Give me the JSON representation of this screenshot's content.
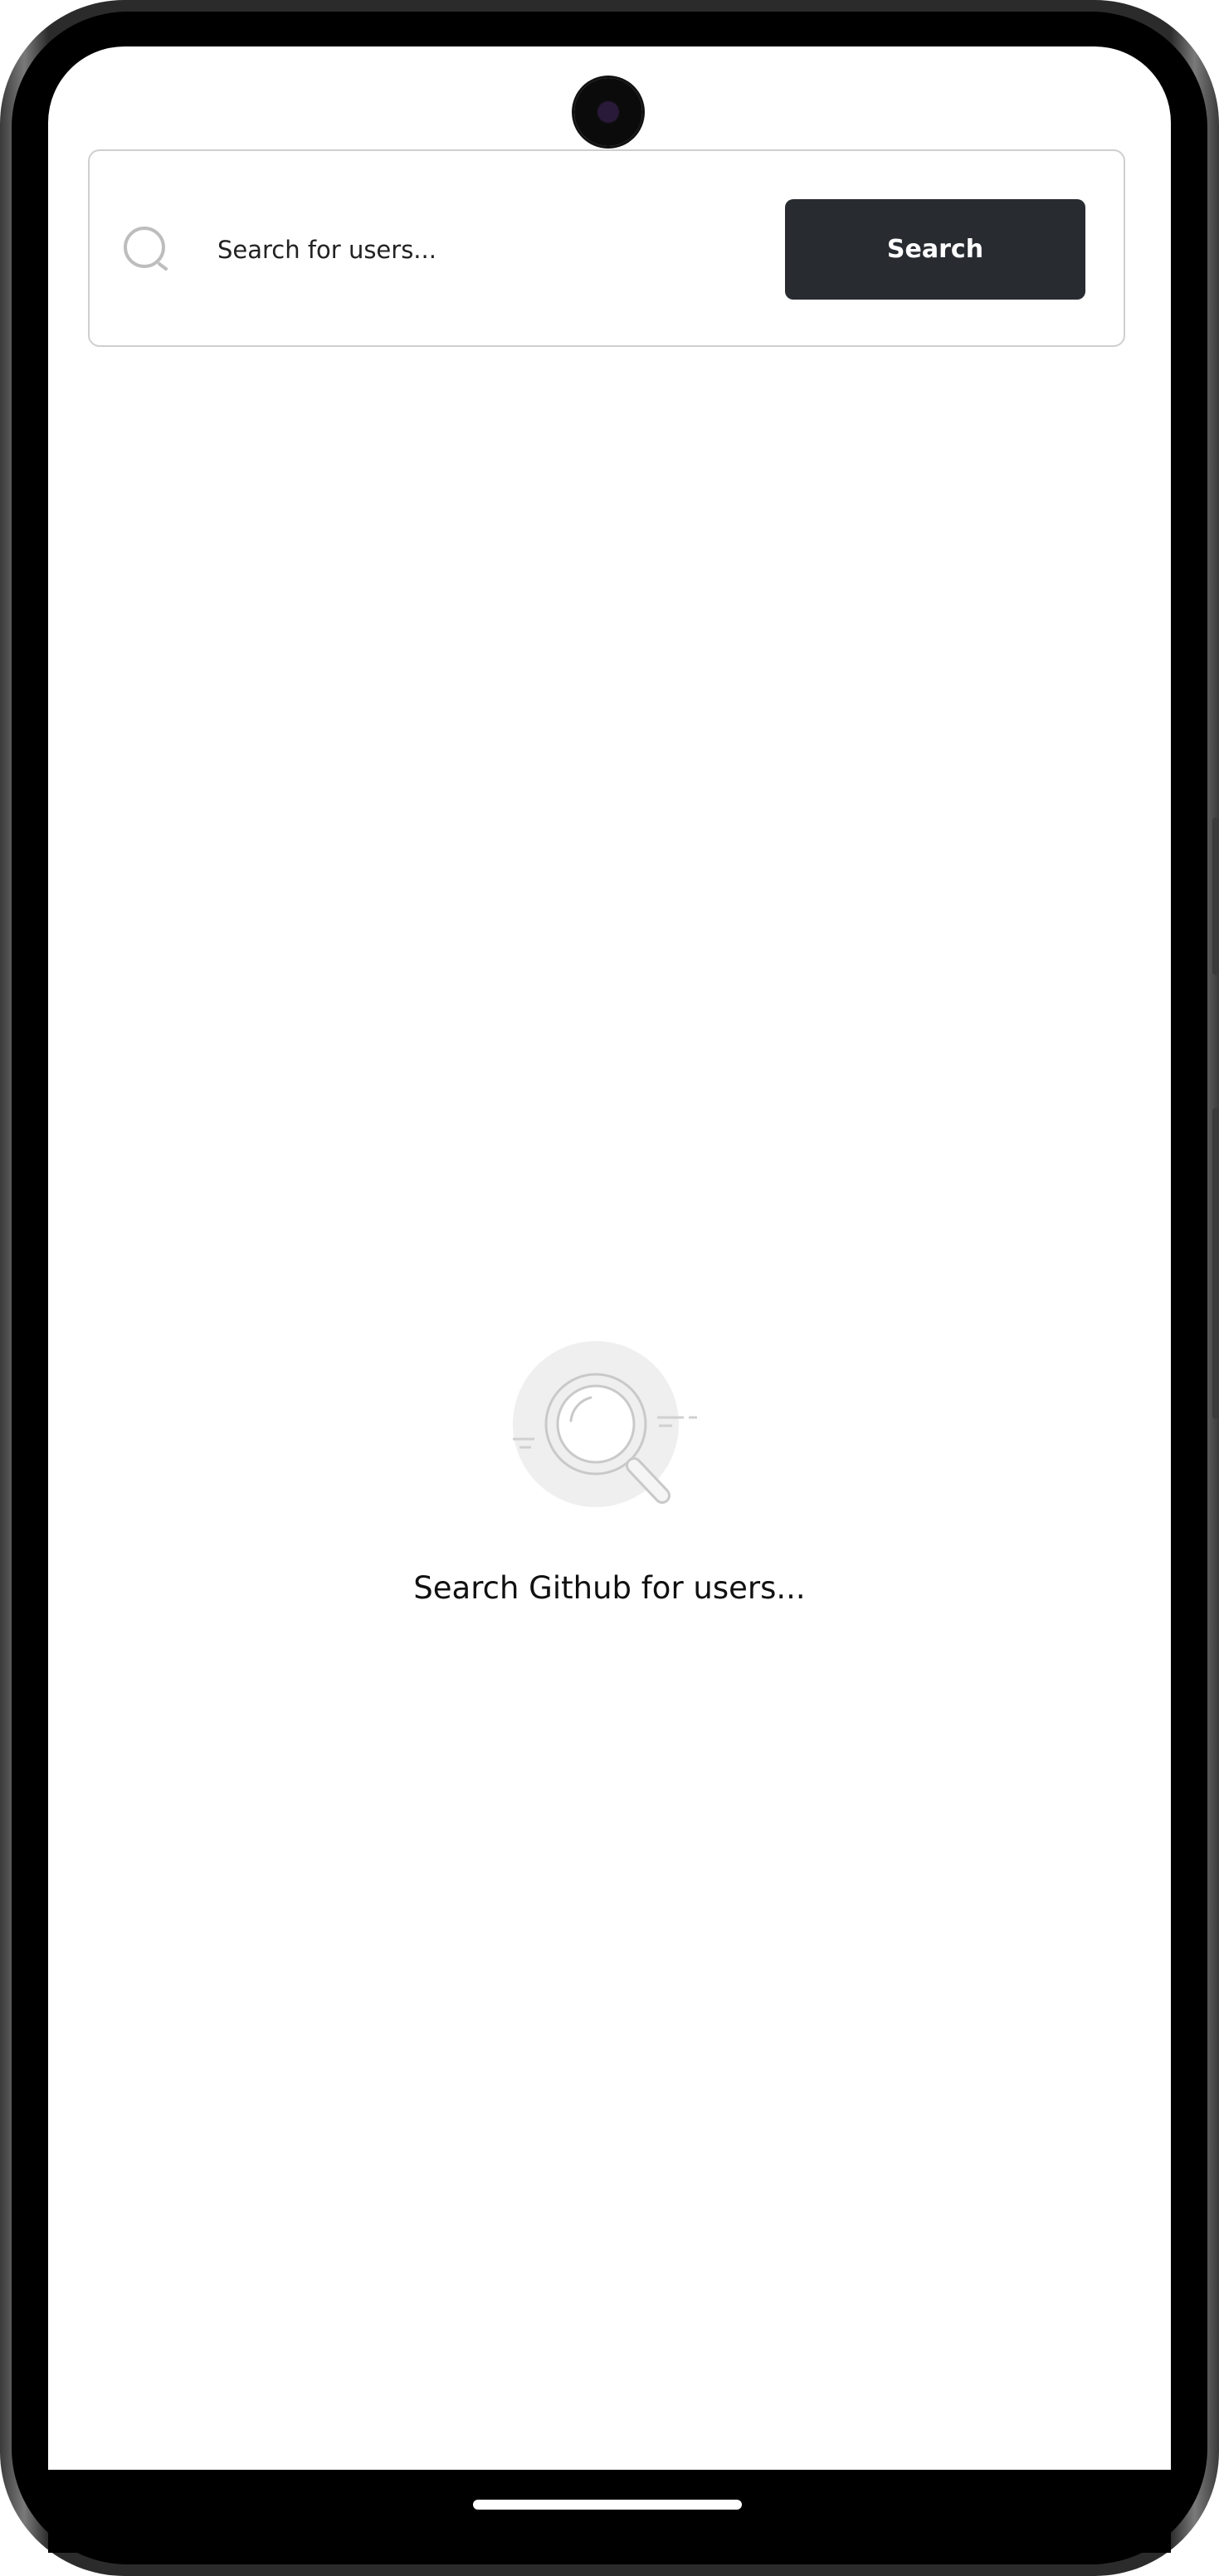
{
  "search": {
    "placeholder": "Search for users...",
    "button_label": "Search"
  },
  "empty_state": {
    "message": "Search Github for users..."
  },
  "icons": {
    "search": "search-icon",
    "illustration": "magnifier-illustration-icon"
  },
  "colors": {
    "button_bg": "#282c31",
    "button_text": "#ffffff",
    "card_border": "#cfcfcf",
    "illustration_bg": "#efefef"
  }
}
